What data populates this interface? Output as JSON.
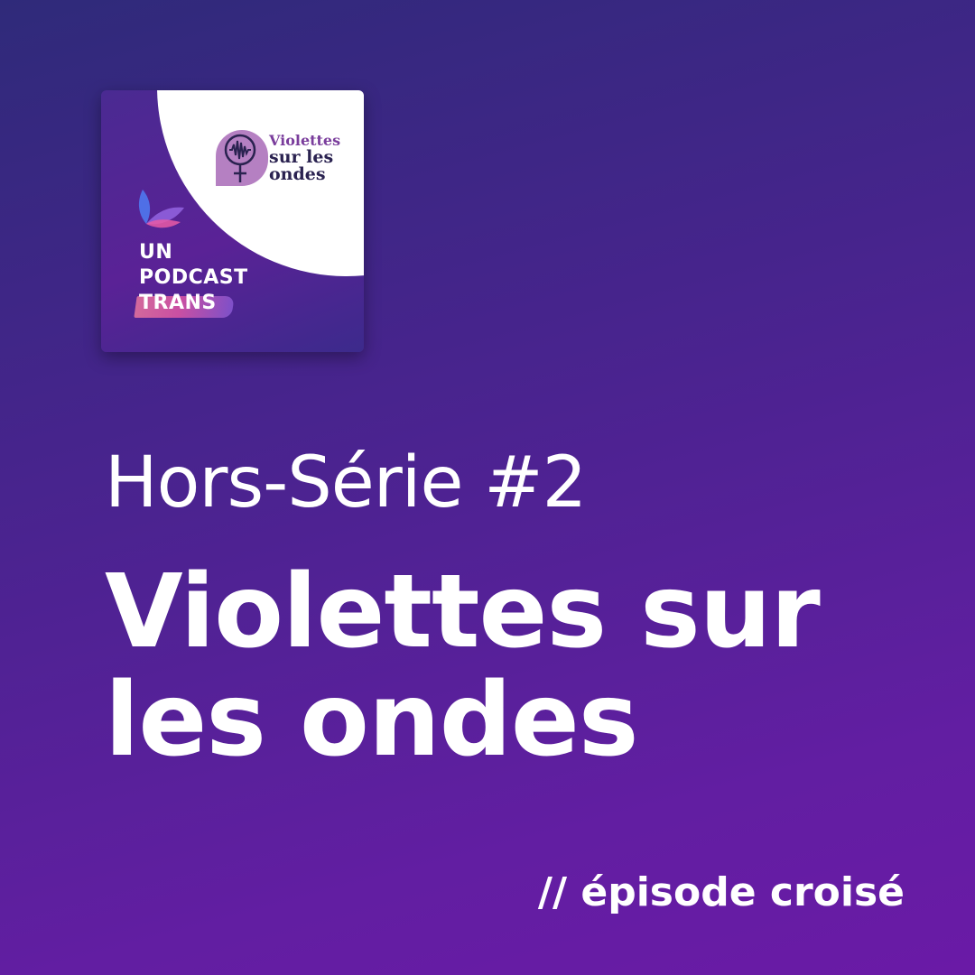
{
  "cover": {
    "logo": {
      "line1": "Violettes",
      "line2": "sur les",
      "line3": "ondes"
    },
    "label": {
      "line1": "UN",
      "line2": "PODCAST",
      "line3": "TRANS"
    }
  },
  "episode": {
    "series": "Hors-Série #2",
    "title_line1": "Violettes sur",
    "title_line2": "les ondes",
    "tagline": "// épisode croisé"
  },
  "colors": {
    "background_top": "#2f2a7a",
    "background_bottom": "#6a1aa6",
    "logo_badge": "#b580c2",
    "logo_accent": "#7a3d9c",
    "trans_highlight": "#f27a9e"
  },
  "icons": [
    "venus-waveform-icon",
    "leaf-icon"
  ]
}
